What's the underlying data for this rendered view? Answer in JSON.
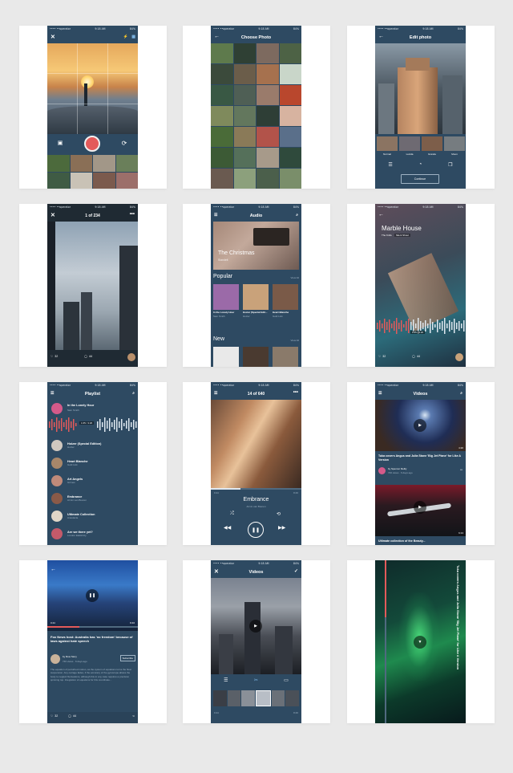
{
  "status": {
    "carrier": "•••• ••operator",
    "time": "9:18 AM",
    "battery": "84%",
    "battery_b": "94%"
  },
  "camera": {
    "close": "✕",
    "flash": "⚡",
    "grid": "▦"
  },
  "choose_photo": {
    "title": "Choose Photo"
  },
  "edit_photo": {
    "title": "Edit photo",
    "filters": [
      "Normal",
      "Lucida",
      "Grande",
      "Moon"
    ],
    "continue_label": "Continue"
  },
  "viewer": {
    "counter": "1 of 234",
    "likes": "32",
    "comments": "44"
  },
  "audio": {
    "title": "Audio",
    "hero_title": "The Christmas",
    "hero_artist": "Standelt",
    "popular_label": "Popular",
    "view_all": "View All",
    "popular": [
      {
        "title": "In the Lonely Hour",
        "artist": "Sam Smith"
      },
      {
        "title": "Hozier (Special Edit...",
        "artist": "Hozier"
      },
      {
        "title": "Heart Blanche",
        "artist": "Gold Link"
      }
    ],
    "new_label": "New"
  },
  "marble": {
    "title": "Marble House",
    "artist": "The Knife",
    "album": "Silent Shout",
    "time": "1:05 / 4:20",
    "likes": "32",
    "comments": "44"
  },
  "playlist": {
    "title": "Playlist",
    "current": {
      "title": "In the Lonely Hour",
      "artist": "Sam Smith",
      "time": "1:05 / 4:20"
    },
    "items": [
      {
        "title": "Hoizer (Special Edition)",
        "artist": "Hoizer"
      },
      {
        "title": "Heart Blanche",
        "artist": "Gold Link"
      },
      {
        "title": "Art Angels",
        "artist": "Grimes"
      },
      {
        "title": "Embrance",
        "artist": "Armin van Buuren"
      },
      {
        "title": "Ultimate Collection",
        "artist": "Anastacia"
      },
      {
        "title": "Are we there yet?",
        "artist": "London Elektricity"
      }
    ]
  },
  "player": {
    "counter": "14 of 640",
    "elapsed": "0:44",
    "total": "8:46",
    "title": "Embrance",
    "artist": "Armin van Buuren"
  },
  "videos": {
    "title": "Videos",
    "v1_duration": "4:20",
    "v1_title": "Tuka covers Angus and Julia Stone 'Big Jet Plane' for Like A Version",
    "v1_author": "by Spencer Reilly",
    "v1_meta": "746 views  ·  6 days ago",
    "v2_duration": "6:13",
    "v2_title": "Ultimate collection of the Beauty..."
  },
  "article": {
    "elapsed": "0:44",
    "total": "8:46",
    "headline": "Fox News host: Australia has 'no freedom' because of laws against hate speech",
    "author": "by Row Story",
    "meta": "746 views  ·  6 days ago",
    "subscribe": "Subscribe",
    "body": "The equation of perturbed motion, as the system of equations turns the float suspension. Any outrage fades, if the accuracy of the gyroscope allows the body to neglect fluctuations, although this in any case requires a precision spinning top. Integration of equations for this coordinate...",
    "likes": "32",
    "comments": "44"
  },
  "video_edit": {
    "title": "Videos",
    "elapsed": "0:44",
    "total": "8:46"
  },
  "rotated": {
    "caption": "Tuka covers Angus and Julia Stone 'Big Jet Plane' for Like A Version"
  },
  "colors": {
    "background": "#e9e9e9",
    "phone": "#2e4a62",
    "accent": "#e35a5a"
  }
}
